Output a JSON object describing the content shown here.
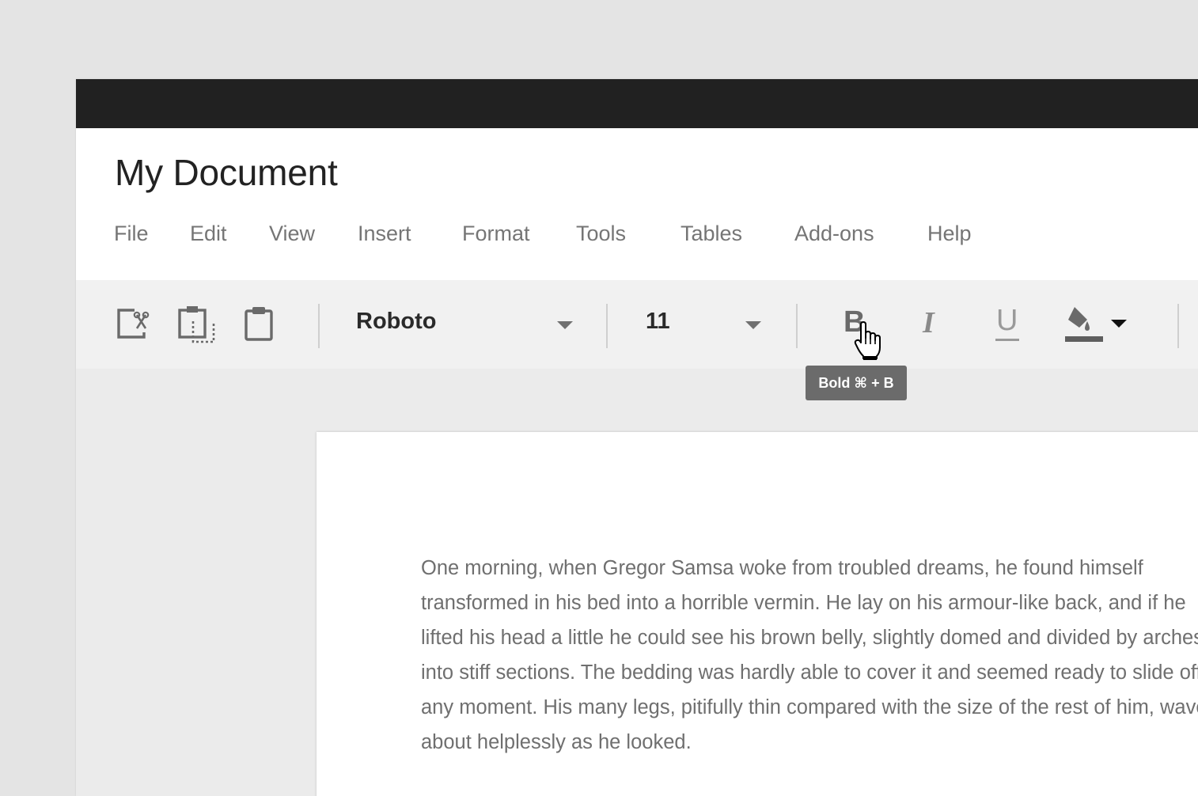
{
  "document": {
    "title": "My Document"
  },
  "menu": [
    "File",
    "Edit",
    "View",
    "Insert",
    "Format",
    "Tools",
    "Tables",
    "Add-ons",
    "Help"
  ],
  "toolbar": {
    "font_family": "Roboto",
    "font_size": "11",
    "bold_glyph": "B",
    "italic_glyph": "I",
    "underline_glyph": "U"
  },
  "tooltip": {
    "text": "Bold ⌘ + B"
  },
  "body_lines": [
    "One morning, when Gregor Samsa woke from troubled dreams, he found himself",
    "transformed in his bed into a horrible vermin. He lay on his armour-like back, and if he",
    "lifted his head a little he could see his brown belly, slightly domed and divided by arches",
    "into stiff sections. The bedding was hardly able to cover it and seemed ready to slide off",
    "any moment. His many legs, pitifully thin compared with the size of the rest of him, waved",
    "about helplessly as he looked."
  ],
  "icons": [
    "cut-icon",
    "copy-icon",
    "paste-icon",
    "caret-down-icon",
    "fill-color-icon",
    "hand-pointer-icon"
  ],
  "colors": {
    "titlebar": "#212121",
    "toolbar": "#f1f1f1",
    "tooltip": "#6b6b6b",
    "text": "#6f6f6f"
  }
}
